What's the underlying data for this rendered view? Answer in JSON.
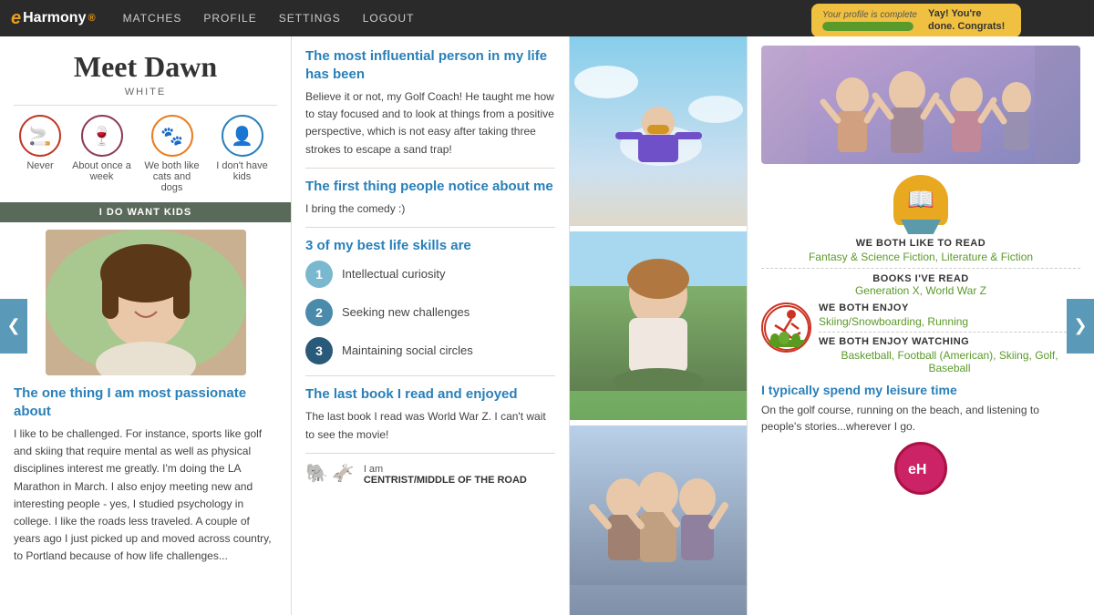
{
  "navbar": {
    "brand": "eHarmony",
    "brand_e": "e",
    "brand_rest": "Harmony",
    "links": [
      "MATCHES",
      "PROFILE",
      "SETTINGS",
      "LOGOUT"
    ],
    "profile_complete_label": "Your profile is complete",
    "profile_complete_congrats": "Yay! You're done. Congrats!",
    "progress_percent": 100
  },
  "left": {
    "title": "Meet Dawn",
    "ethnicity": "WHITE",
    "icons": [
      {
        "label": "Never",
        "symbol": "🚫",
        "style": "red"
      },
      {
        "label": "About once a week",
        "symbol": "🍷",
        "style": "wine"
      },
      {
        "label": "We both like cats and dogs",
        "symbol": "🐾",
        "style": "paw"
      },
      {
        "label": "I don't have kids",
        "symbol": "👤",
        "style": "person"
      }
    ],
    "want_kids_banner": "I DO WANT KIDS",
    "passionate_title": "The one thing I am most passionate about",
    "passionate_text": "I like to be challenged. For instance, sports like golf and skiing that require mental as well as physical disciplines interest me greatly. I'm doing the LA Marathon in March. I also enjoy meeting new and interesting people - yes, I studied psychology in college. I like the roads less traveled. A couple of years ago I just picked up and moved across country, to Portland because of how life challenges..."
  },
  "mid": {
    "section1_title": "The most influential person in my life has been",
    "section1_text": "Believe it or not, my Golf Coach! He taught me how to stay focused and to look at things from a positive perspective, which is not easy after taking three strokes to escape a sand trap!",
    "section2_title": "The first thing people notice about me",
    "section2_text": "I bring the comedy :)",
    "section3_title": "3 of my best life skills are",
    "skills": [
      {
        "num": "1",
        "text": "Intellectual curiosity",
        "class": "n1"
      },
      {
        "num": "2",
        "text": "Seeking new challenges",
        "class": "n2"
      },
      {
        "num": "3",
        "text": "Maintaining social circles",
        "class": "n3"
      }
    ],
    "section4_title": "The last book I read and enjoyed",
    "section4_text": "The last book I read was World War Z. I can't wait to see the movie!",
    "political_label": "I am",
    "political_value": "CENTRIST/MIDDLE OF THE ROAD"
  },
  "photos": {
    "skydive_emoji": "🪂",
    "girl_emoji": "🌿",
    "group_emoji": "👥"
  },
  "right": {
    "group_photo_emoji": "🎉",
    "we_both_read_label": "WE BOTH LIKE TO READ",
    "we_both_read_value": "Fantasy & Science Fiction, Literature & Fiction",
    "books_label": "BOOKS I'VE READ",
    "books_value": "Generation X, World War Z",
    "book_emoji": "📖",
    "we_both_enjoy_label": "WE BOTH ENJOY",
    "we_both_enjoy_value": "Skiing/Snowboarding, Running",
    "we_both_watch_label": "WE BOTH ENJOY WATCHING",
    "we_both_watch_value": "Basketball, Football (American), Skiing, Golf, Baseball",
    "running_emoji": "🏃",
    "leisure_title": "I typically spend my leisure time",
    "leisure_text": "On the golf course, running on the beach, and listening to people's stories...wherever I go.",
    "harmony_emoji": "♾"
  }
}
